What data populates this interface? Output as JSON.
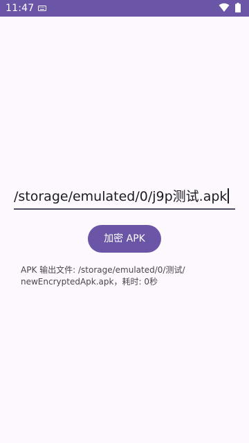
{
  "status_bar": {
    "time": "11:47",
    "icons": [
      "keyboard-icon",
      "wifi-icon",
      "battery-icon"
    ],
    "background_color": "#6a55a6"
  },
  "path_input": {
    "value": "/storage/emulated/0/j9p测试.apk"
  },
  "encrypt_button": {
    "label": "加密 APK",
    "color": "#6a55a6"
  },
  "output": {
    "line1": "APK 输出文件: /storage/emulated/0/测试/",
    "line2": "newEncryptedApk.apk，耗时: 0秒"
  }
}
